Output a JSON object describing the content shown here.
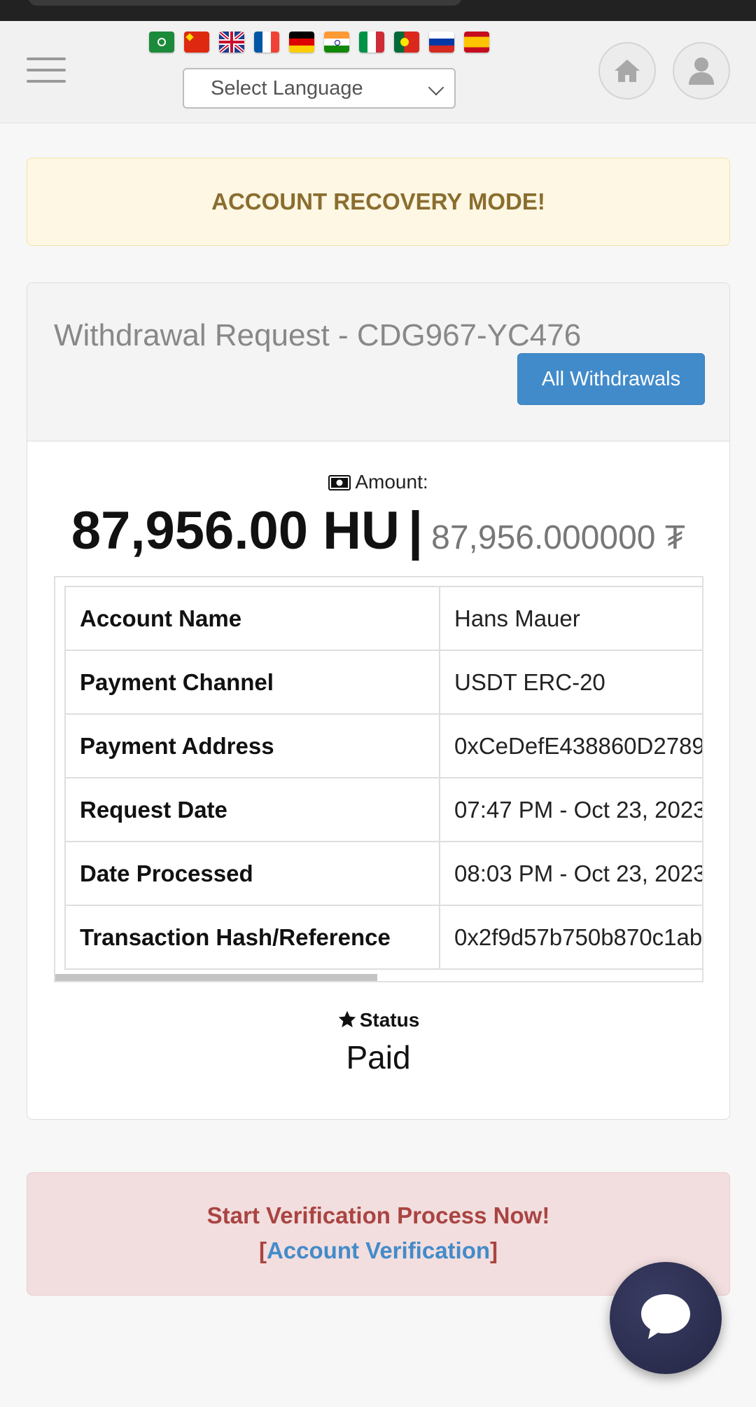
{
  "header": {
    "flags": [
      {
        "name": "arabic-flag-icon",
        "color": "#1b8a3a"
      },
      {
        "name": "chinese-flag-icon",
        "color": "#de2910"
      },
      {
        "name": "uk-flag-icon",
        "color": "#1f3c8c"
      },
      {
        "name": "french-flag-icon",
        "color": "#0055a4"
      },
      {
        "name": "german-flag-icon",
        "color": "#000000"
      },
      {
        "name": "indian-flag-icon",
        "color": "#ff9933"
      },
      {
        "name": "italian-flag-icon",
        "color": "#009246"
      },
      {
        "name": "portuguese-flag-icon",
        "color": "#046a38"
      },
      {
        "name": "russian-flag-icon",
        "color": "#0039a6"
      },
      {
        "name": "spanish-flag-icon",
        "color": "#c60b1e"
      }
    ],
    "language_select": "Select Language",
    "icons": [
      "menu-icon",
      "home-icon",
      "user-icon"
    ]
  },
  "alert_warning": "ACCOUNT RECOVERY MODE!",
  "card": {
    "title": "Withdrawal Request - CDG967-YC476",
    "all_withdrawals_button": "All Withdrawals",
    "amount_label": "Amount:",
    "amount_main": "87,956.00 HU",
    "amount_separator": "|",
    "amount_sub": "87,956.000000 ₮",
    "rows": [
      {
        "key": "Account Name",
        "value": "Hans Mauer"
      },
      {
        "key": "Payment Channel",
        "value": "USDT ERC-20"
      },
      {
        "key": "Payment Address",
        "value": "0xCeDefE438860D2789"
      },
      {
        "key": "Request Date",
        "value": "07:47 PM - Oct 23, 2023"
      },
      {
        "key": "Date Processed",
        "value": "08:03 PM - Oct 23, 2023"
      },
      {
        "key": "Transaction Hash/Reference",
        "value": "0x2f9d57b750b870c1ab"
      }
    ],
    "status_label": "Status",
    "status_value": "Paid"
  },
  "alert_danger": {
    "line1": "Start Verification Process Now!",
    "bracket_open": "[",
    "link": "Account Verification",
    "bracket_close": "]"
  },
  "colors": {
    "primary": "#428bca",
    "warning_text": "#8a6d2f",
    "danger_text": "#a94442",
    "chat_bubble": "#2b2d4f"
  }
}
